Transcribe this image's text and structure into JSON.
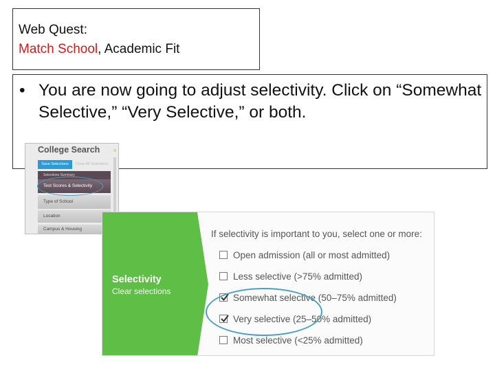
{
  "title": {
    "line1": "Web Quest:",
    "line2_red": "Match School",
    "line2_rest": ", Academic Fit"
  },
  "bullet": {
    "dot": "•",
    "text": "You are now going to adjust selectivity.  Click on “Somewhat Selective,” “Very Selective,” or both."
  },
  "college_search": {
    "title": "College Search",
    "save_label": "Save Selections",
    "clear_label": "Clear All Selections",
    "items": [
      "Selections Summary",
      "Test Scores & Selectivity",
      "Type of School",
      "Location",
      "Campus & Housing"
    ]
  },
  "selectivity": {
    "label": "Selectivity",
    "clear_label": "Clear selections",
    "prompt": "If selectivity is important to you, select one or more:",
    "options": [
      {
        "label": "Open admission (all or most admitted)",
        "checked": false
      },
      {
        "label": "Less selective (>75% admitted)",
        "checked": false
      },
      {
        "label": "Somewhat selective (50–75% admitted)",
        "checked": true
      },
      {
        "label": "Very selective (25–50% admitted)",
        "checked": true
      },
      {
        "label": "Most selective (<25% admitted)",
        "checked": false
      }
    ]
  },
  "colors": {
    "title_red": "#d11a1a",
    "green_panel": "#5fbe45",
    "highlight_ring": "#4aa0bf",
    "save_blue": "#2a9bd6"
  }
}
